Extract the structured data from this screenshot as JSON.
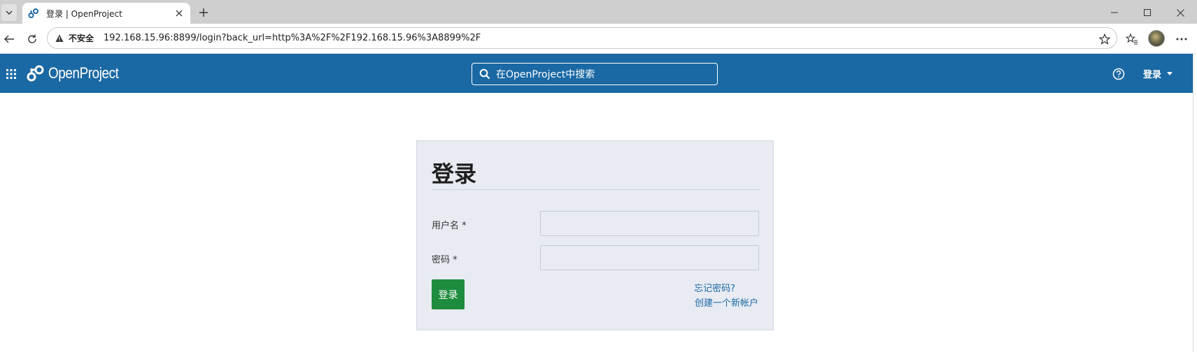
{
  "browser": {
    "tab": {
      "title": "登录 | OpenProject"
    },
    "address": {
      "security_label": "不安全",
      "url": "192.168.15.96:8899/login?back_url=http%3A%2F%2F192.168.15.96%3A8899%2F"
    }
  },
  "header": {
    "logo_text": "OpenProject",
    "search_placeholder": "在OpenProject中搜索",
    "login_menu_label": "登录"
  },
  "login": {
    "title": "登录",
    "username_label": "用户名 *",
    "password_label": "密码 *",
    "username_value": "",
    "password_value": "",
    "submit_label": "登录",
    "forgot_password": "忘记密码?",
    "register": "创建一个新帐户"
  },
  "colors": {
    "header_bg": "#1b69a4",
    "login_box_bg": "#e8ebf2",
    "submit_bg": "#1e8c3e",
    "link": "#1b69a4"
  },
  "icons": [
    "tab-search-icon",
    "openproject-favicon-icon",
    "close-icon",
    "plus-icon",
    "minimize-icon",
    "maximize-icon",
    "close-window-icon",
    "back-arrow-icon",
    "reload-icon",
    "warning-icon",
    "star-icon",
    "favorites-icon",
    "more-icon",
    "grid-menu-icon",
    "openproject-logo-icon",
    "search-icon",
    "help-icon",
    "caret-down-icon"
  ]
}
